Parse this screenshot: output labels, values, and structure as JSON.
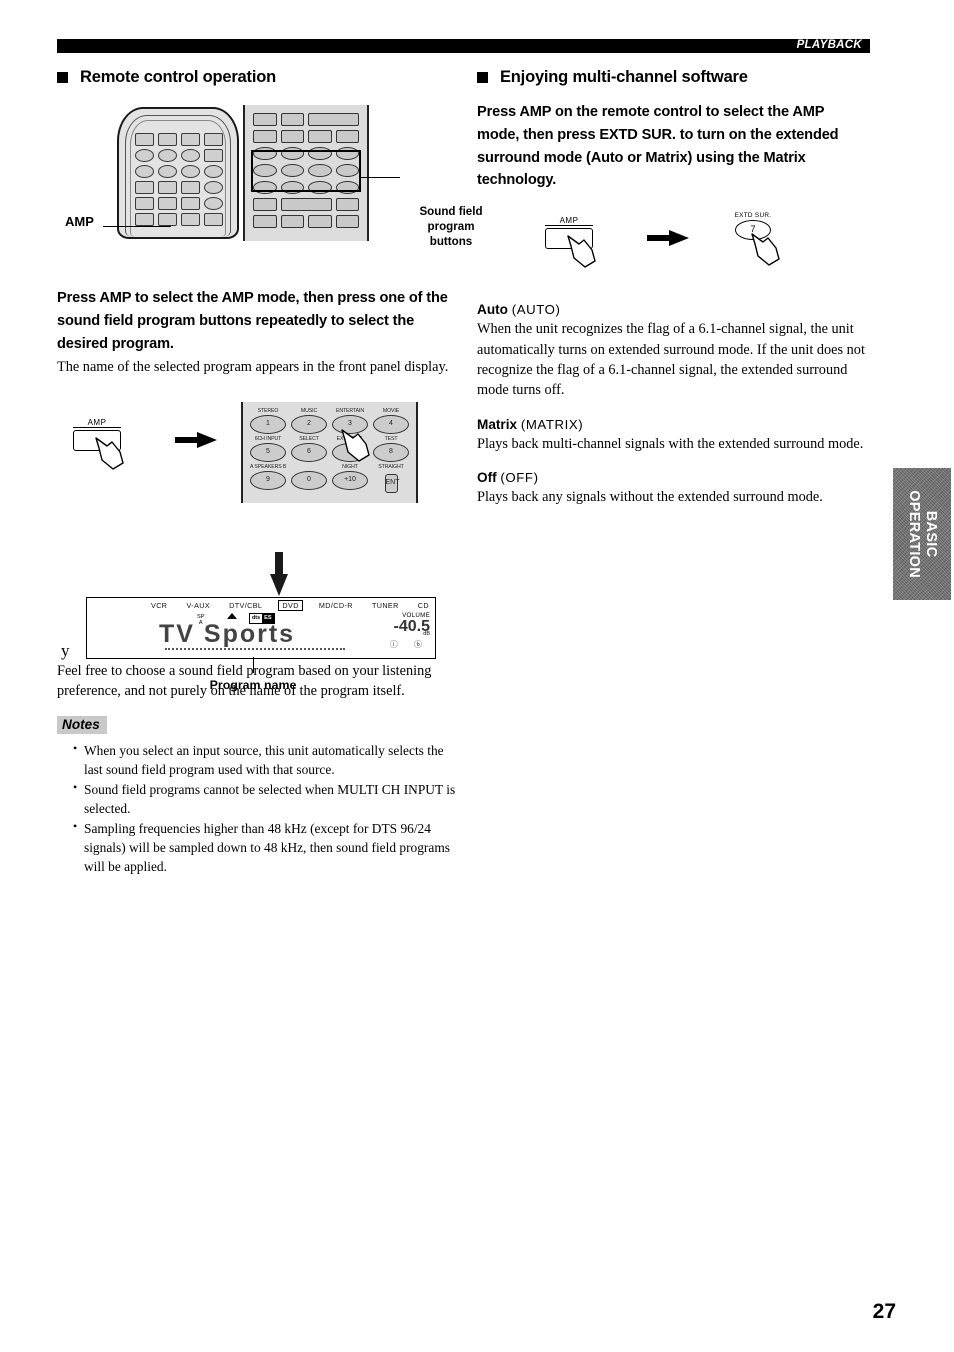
{
  "header": {
    "banner_label": "PLAYBACK"
  },
  "page_number": "27",
  "side_tab": {
    "line1": "BASIC",
    "line2": "OPERATION"
  },
  "left_column": {
    "heading": "Remote control operation",
    "diagram": {
      "label_amp": "AMP",
      "label_sound_field": "Sound field program buttons",
      "sound_field_label_lines": [
        "Sound field",
        "program",
        "buttons"
      ]
    },
    "lead_paragraph": "Press AMP to select the AMP mode, then press one of the sound field program buttons repeatedly to select the desired program.",
    "body_paragraph": "The name of the selected program appears in the front panel display.",
    "press_diagram": {
      "amp_button_label": "AMP",
      "keypad_rows": [
        [
          {
            "label": "STEREO",
            "key": "1"
          },
          {
            "label": "MUSIC",
            "key": "2"
          },
          {
            "label": "ENTERTAIN",
            "key": "3"
          },
          {
            "label": "MOVIE",
            "key": "4"
          }
        ],
        [
          {
            "label": "6CH INPUT",
            "key": "5"
          },
          {
            "label": "SELECT",
            "key": "6"
          },
          {
            "label": "EXTD SUR.",
            "key": "7"
          },
          {
            "label": "TEST",
            "key": "8"
          }
        ],
        [
          {
            "label": "A SPEAKERS B",
            "key": "9"
          },
          {
            "label": "",
            "key": "0"
          },
          {
            "label": "NIGHT",
            "key": "+10"
          },
          {
            "label": "STRAIGHT",
            "key": "ENT"
          }
        ]
      ]
    },
    "front_panel_display": {
      "sources": [
        "VCR",
        "V-AUX",
        "DTV/CBL",
        "DVD",
        "MD/CD-R",
        "TUNER",
        "CD"
      ],
      "selected_source": "DVD",
      "sp_label_line1": "SP",
      "sp_label_line2": "A",
      "format_badge_left": "dts",
      "format_badge_right": "ES",
      "program_name": "TV Sports",
      "volume_label": "VOLUME",
      "volume_value": "-40.5",
      "volume_unit": "dB",
      "status_icons": "ⓘ ⓑ"
    },
    "display_caption": "Program name",
    "tip": {
      "marker": "y",
      "text": "Feel free to choose a sound field program based on your listening preference, and not purely on the name of the program itself."
    },
    "notes": {
      "title": "Notes",
      "items": [
        "When you select an input source, this unit automatically selects the last sound field program used with that source.",
        "Sound field programs cannot be selected when MULTI CH INPUT is selected.",
        "Sampling frequencies higher than 48 kHz (except for DTS 96/24 signals) will be sampled down to 48 kHz, then sound field programs will be applied."
      ]
    }
  },
  "right_column": {
    "heading": "Enjoying multi-channel software",
    "lead_paragraph": "Press AMP on the remote control to select the AMP mode, then press EXTD SUR. to turn on the extended surround mode (Auto or Matrix) using the Matrix technology.",
    "press_diagram": {
      "amp_button_label": "AMP",
      "extd_button_caption": "EXTD SUR.",
      "extd_button_key": "7"
    },
    "modes": [
      {
        "name": "Auto",
        "code": "(AUTO)",
        "description": "When the unit recognizes the flag of a 6.1-channel signal, the unit automatically turns on extended surround mode. If the unit does not recognize the flag of a 6.1-channel signal, the extended surround mode turns off."
      },
      {
        "name": "Matrix",
        "code": "(MATRIX)",
        "description": "Plays back multi-channel signals with the extended surround mode."
      },
      {
        "name": "Off",
        "code": "(OFF)",
        "description": "Plays back any signals without the extended surround mode."
      }
    ]
  }
}
